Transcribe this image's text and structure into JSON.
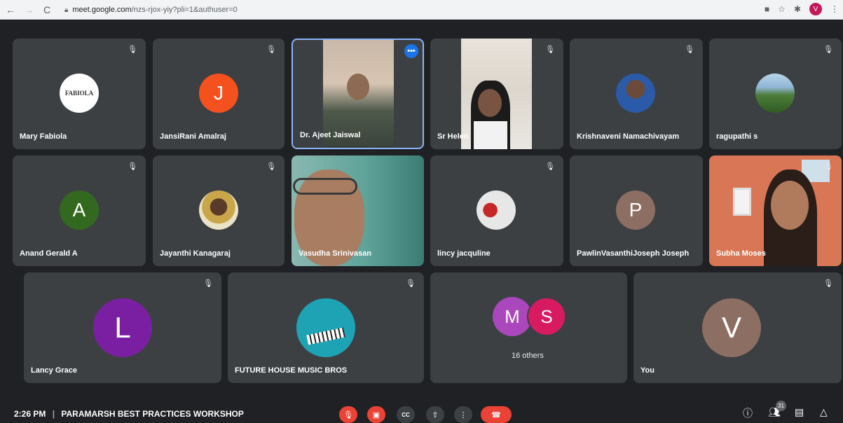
{
  "browser": {
    "url_host": "meet.google.com",
    "url_path": "/nzs-rjox-yiy?pli=1&authuser=0",
    "profile_initial": "V"
  },
  "participants": [
    {
      "name": "Mary Fabiola",
      "logo_text": "FABIOLA"
    },
    {
      "name": "JansiRani Amalraj",
      "initial": "J",
      "color": "#f4511e"
    },
    {
      "name": "Dr. Ajeet Jaiswal"
    },
    {
      "name": "Sr Helen"
    },
    {
      "name": "Krishnaveni Namachivayam"
    },
    {
      "name": "ragupathi s"
    },
    {
      "name": "Anand Gerald A",
      "initial": "A",
      "color": "#33691e"
    },
    {
      "name": "Jayanthi Kanagaraj"
    },
    {
      "name": "Vasudha Srinivasan"
    },
    {
      "name": "lincy jacquline"
    },
    {
      "name": "PawlinVasanthiJoseph Joseph",
      "initial": "P",
      "color": "#8d6e63"
    },
    {
      "name": "Subha Moses"
    },
    {
      "name": "Lancy Grace",
      "initial": "L",
      "color": "#7b1fa2"
    },
    {
      "name": "FUTURE HOUSE MUSIC BROS"
    },
    {
      "others_text": "16 others",
      "initials": [
        "M",
        "S"
      ],
      "colors": [
        "#ab47bc",
        "#d81b60"
      ]
    },
    {
      "name": "You",
      "initial": "V",
      "color": "#8d6e63"
    }
  ],
  "meeting": {
    "time": "2:26 PM",
    "separator": "|",
    "title": "PARAMARSH BEST PRACTICES WORKSHOP",
    "participant_count": "31"
  }
}
